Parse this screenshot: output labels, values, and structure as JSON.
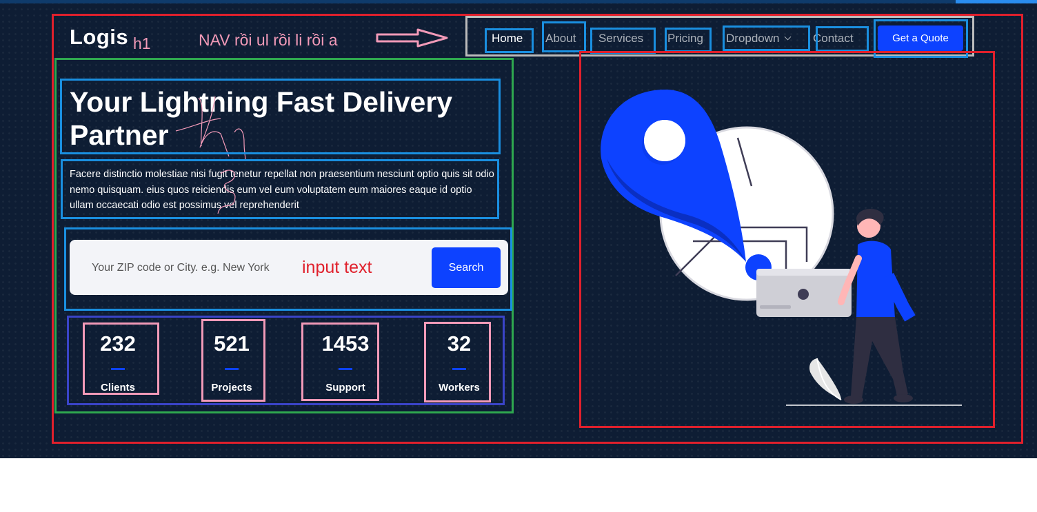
{
  "header": {
    "logo": "Logis",
    "notes": {
      "h1": "h1",
      "nav": "NAV rồi ul rồi li rồi a"
    },
    "nav": [
      {
        "label": "Home"
      },
      {
        "label": "About"
      },
      {
        "label": "Services"
      },
      {
        "label": "Pricing"
      },
      {
        "label": "Dropdown"
      },
      {
        "label": "Contact"
      }
    ],
    "cta_label": "Get a Quote"
  },
  "hero": {
    "title": "Your Lightning Fast Delivery Partner",
    "description": "Facere distinctio molestiae nisi fugit tenetur repellat non praesentium nesciunt optio quis sit odio nemo quisquam. eius quos reiciendis eum vel eum voluptatem eum maiores eaque id optio ullam occaecati odio est possimus vel reprehenderit",
    "search": {
      "placeholder": "Your ZIP code or City. e.g. New York",
      "button_label": "Search",
      "note": "input text"
    },
    "stats": [
      {
        "value": "232",
        "label": "Clients"
      },
      {
        "value": "521",
        "label": "Projects"
      },
      {
        "value": "1453",
        "label": "Support"
      },
      {
        "value": "32",
        "label": "Workers"
      }
    ]
  },
  "colors": {
    "background": "#0e1d34",
    "accent": "#0d42ff",
    "annotation_red": "#e0202c",
    "annotation_blue": "#1a8fe0",
    "annotation_pink": "#f29ab8",
    "annotation_green": "#2fa84f"
  }
}
